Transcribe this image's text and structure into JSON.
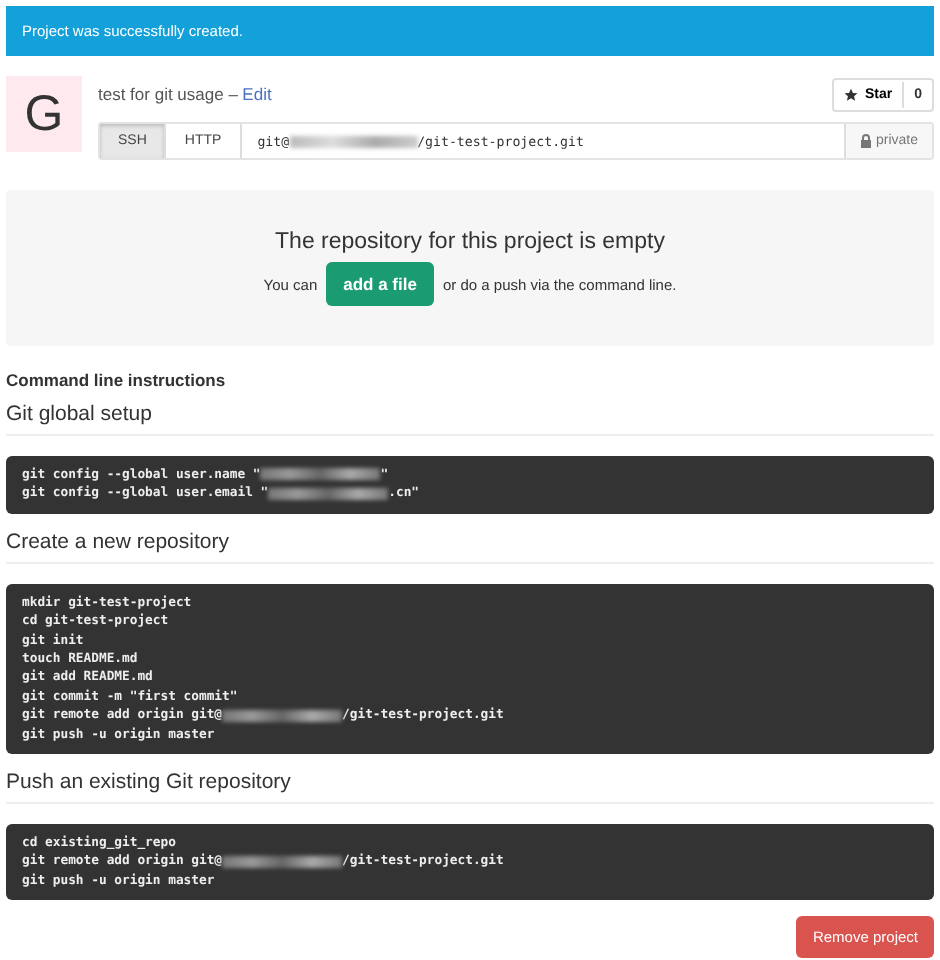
{
  "flash": {
    "text": "Project was successfully created."
  },
  "project": {
    "avatar_letter": "G",
    "title": "test for git usage –",
    "edit_link": "Edit"
  },
  "star": {
    "label": "Star",
    "count": "0"
  },
  "clone": {
    "protocols": [
      {
        "label": "SSH",
        "selected": true
      },
      {
        "label": "HTTP",
        "selected": false
      }
    ],
    "url": [
      {
        "kind": "text",
        "text": "git@"
      },
      {
        "kind": "blur"
      },
      {
        "kind": "text",
        "text": "/git-test-project.git"
      }
    ],
    "visibility": "private"
  },
  "empty": {
    "heading": "The repository for this project is empty",
    "before": "You can",
    "button": "add a file",
    "after": "or do a push via the command line."
  },
  "instructions": {
    "title": "Command line instructions",
    "sections": [
      {
        "heading": "Git global setup",
        "lines": [
          [
            {
              "kind": "text",
              "text": "git config --global user.name \""
            },
            {
              "kind": "blur"
            },
            {
              "kind": "text",
              "text": "\""
            }
          ],
          [
            {
              "kind": "text",
              "text": "git config --global user.email \""
            },
            {
              "kind": "blur"
            },
            {
              "kind": "text",
              "text": ".cn\""
            }
          ]
        ]
      },
      {
        "heading": "Create a new repository",
        "lines": [
          [
            {
              "kind": "text",
              "text": "mkdir git-test-project"
            }
          ],
          [
            {
              "kind": "text",
              "text": "cd git-test-project"
            }
          ],
          [
            {
              "kind": "text",
              "text": "git init"
            }
          ],
          [
            {
              "kind": "text",
              "text": "touch README.md"
            }
          ],
          [
            {
              "kind": "text",
              "text": "git add README.md"
            }
          ],
          [
            {
              "kind": "text",
              "text": "git commit -m \"first commit\""
            }
          ],
          [
            {
              "kind": "text",
              "text": "git remote add origin git@"
            },
            {
              "kind": "blur"
            },
            {
              "kind": "text",
              "text": "/git-test-project.git"
            }
          ],
          [
            {
              "kind": "text",
              "text": "git push -u origin master"
            }
          ]
        ]
      },
      {
        "heading": "Push an existing Git repository",
        "lines": [
          [
            {
              "kind": "text",
              "text": "cd existing_git_repo"
            }
          ],
          [
            {
              "kind": "text",
              "text": "git remote add origin git@"
            },
            {
              "kind": "blur"
            },
            {
              "kind": "text",
              "text": "/git-test-project.git"
            }
          ],
          [
            {
              "kind": "text",
              "text": "git push -u origin master"
            }
          ]
        ]
      }
    ]
  },
  "remove_button": "Remove project"
}
